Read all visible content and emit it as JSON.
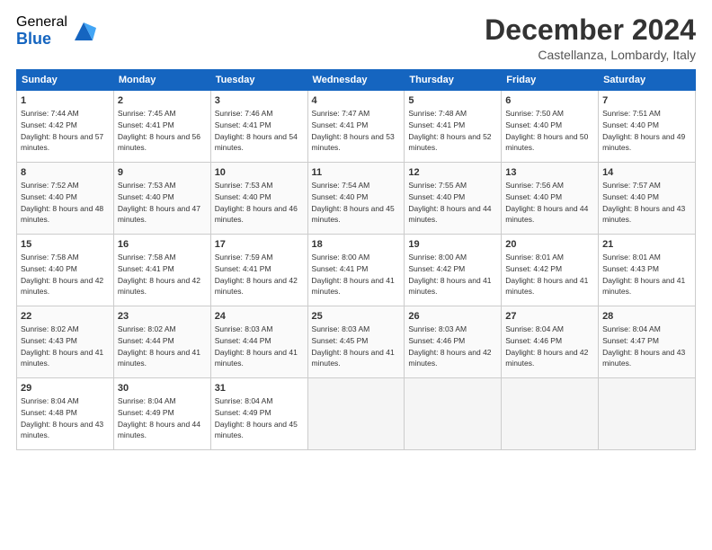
{
  "logo": {
    "general": "General",
    "blue": "Blue"
  },
  "title": "December 2024",
  "subtitle": "Castellanza, Lombardy, Italy",
  "header_days": [
    "Sunday",
    "Monday",
    "Tuesday",
    "Wednesday",
    "Thursday",
    "Friday",
    "Saturday"
  ],
  "weeks": [
    [
      {
        "day": "1",
        "sunrise": "7:44 AM",
        "sunset": "4:42 PM",
        "daylight": "8 hours and 57 minutes."
      },
      {
        "day": "2",
        "sunrise": "7:45 AM",
        "sunset": "4:41 PM",
        "daylight": "8 hours and 56 minutes."
      },
      {
        "day": "3",
        "sunrise": "7:46 AM",
        "sunset": "4:41 PM",
        "daylight": "8 hours and 54 minutes."
      },
      {
        "day": "4",
        "sunrise": "7:47 AM",
        "sunset": "4:41 PM",
        "daylight": "8 hours and 53 minutes."
      },
      {
        "day": "5",
        "sunrise": "7:48 AM",
        "sunset": "4:41 PM",
        "daylight": "8 hours and 52 minutes."
      },
      {
        "day": "6",
        "sunrise": "7:50 AM",
        "sunset": "4:40 PM",
        "daylight": "8 hours and 50 minutes."
      },
      {
        "day": "7",
        "sunrise": "7:51 AM",
        "sunset": "4:40 PM",
        "daylight": "8 hours and 49 minutes."
      }
    ],
    [
      {
        "day": "8",
        "sunrise": "7:52 AM",
        "sunset": "4:40 PM",
        "daylight": "8 hours and 48 minutes."
      },
      {
        "day": "9",
        "sunrise": "7:53 AM",
        "sunset": "4:40 PM",
        "daylight": "8 hours and 47 minutes."
      },
      {
        "day": "10",
        "sunrise": "7:53 AM",
        "sunset": "4:40 PM",
        "daylight": "8 hours and 46 minutes."
      },
      {
        "day": "11",
        "sunrise": "7:54 AM",
        "sunset": "4:40 PM",
        "daylight": "8 hours and 45 minutes."
      },
      {
        "day": "12",
        "sunrise": "7:55 AM",
        "sunset": "4:40 PM",
        "daylight": "8 hours and 44 minutes."
      },
      {
        "day": "13",
        "sunrise": "7:56 AM",
        "sunset": "4:40 PM",
        "daylight": "8 hours and 44 minutes."
      },
      {
        "day": "14",
        "sunrise": "7:57 AM",
        "sunset": "4:40 PM",
        "daylight": "8 hours and 43 minutes."
      }
    ],
    [
      {
        "day": "15",
        "sunrise": "7:58 AM",
        "sunset": "4:40 PM",
        "daylight": "8 hours and 42 minutes."
      },
      {
        "day": "16",
        "sunrise": "7:58 AM",
        "sunset": "4:41 PM",
        "daylight": "8 hours and 42 minutes."
      },
      {
        "day": "17",
        "sunrise": "7:59 AM",
        "sunset": "4:41 PM",
        "daylight": "8 hours and 42 minutes."
      },
      {
        "day": "18",
        "sunrise": "8:00 AM",
        "sunset": "4:41 PM",
        "daylight": "8 hours and 41 minutes."
      },
      {
        "day": "19",
        "sunrise": "8:00 AM",
        "sunset": "4:42 PM",
        "daylight": "8 hours and 41 minutes."
      },
      {
        "day": "20",
        "sunrise": "8:01 AM",
        "sunset": "4:42 PM",
        "daylight": "8 hours and 41 minutes."
      },
      {
        "day": "21",
        "sunrise": "8:01 AM",
        "sunset": "4:43 PM",
        "daylight": "8 hours and 41 minutes."
      }
    ],
    [
      {
        "day": "22",
        "sunrise": "8:02 AM",
        "sunset": "4:43 PM",
        "daylight": "8 hours and 41 minutes."
      },
      {
        "day": "23",
        "sunrise": "8:02 AM",
        "sunset": "4:44 PM",
        "daylight": "8 hours and 41 minutes."
      },
      {
        "day": "24",
        "sunrise": "8:03 AM",
        "sunset": "4:44 PM",
        "daylight": "8 hours and 41 minutes."
      },
      {
        "day": "25",
        "sunrise": "8:03 AM",
        "sunset": "4:45 PM",
        "daylight": "8 hours and 41 minutes."
      },
      {
        "day": "26",
        "sunrise": "8:03 AM",
        "sunset": "4:46 PM",
        "daylight": "8 hours and 42 minutes."
      },
      {
        "day": "27",
        "sunrise": "8:04 AM",
        "sunset": "4:46 PM",
        "daylight": "8 hours and 42 minutes."
      },
      {
        "day": "28",
        "sunrise": "8:04 AM",
        "sunset": "4:47 PM",
        "daylight": "8 hours and 43 minutes."
      }
    ],
    [
      {
        "day": "29",
        "sunrise": "8:04 AM",
        "sunset": "4:48 PM",
        "daylight": "8 hours and 43 minutes."
      },
      {
        "day": "30",
        "sunrise": "8:04 AM",
        "sunset": "4:49 PM",
        "daylight": "8 hours and 44 minutes."
      },
      {
        "day": "31",
        "sunrise": "8:04 AM",
        "sunset": "4:49 PM",
        "daylight": "8 hours and 45 minutes."
      },
      null,
      null,
      null,
      null
    ]
  ]
}
